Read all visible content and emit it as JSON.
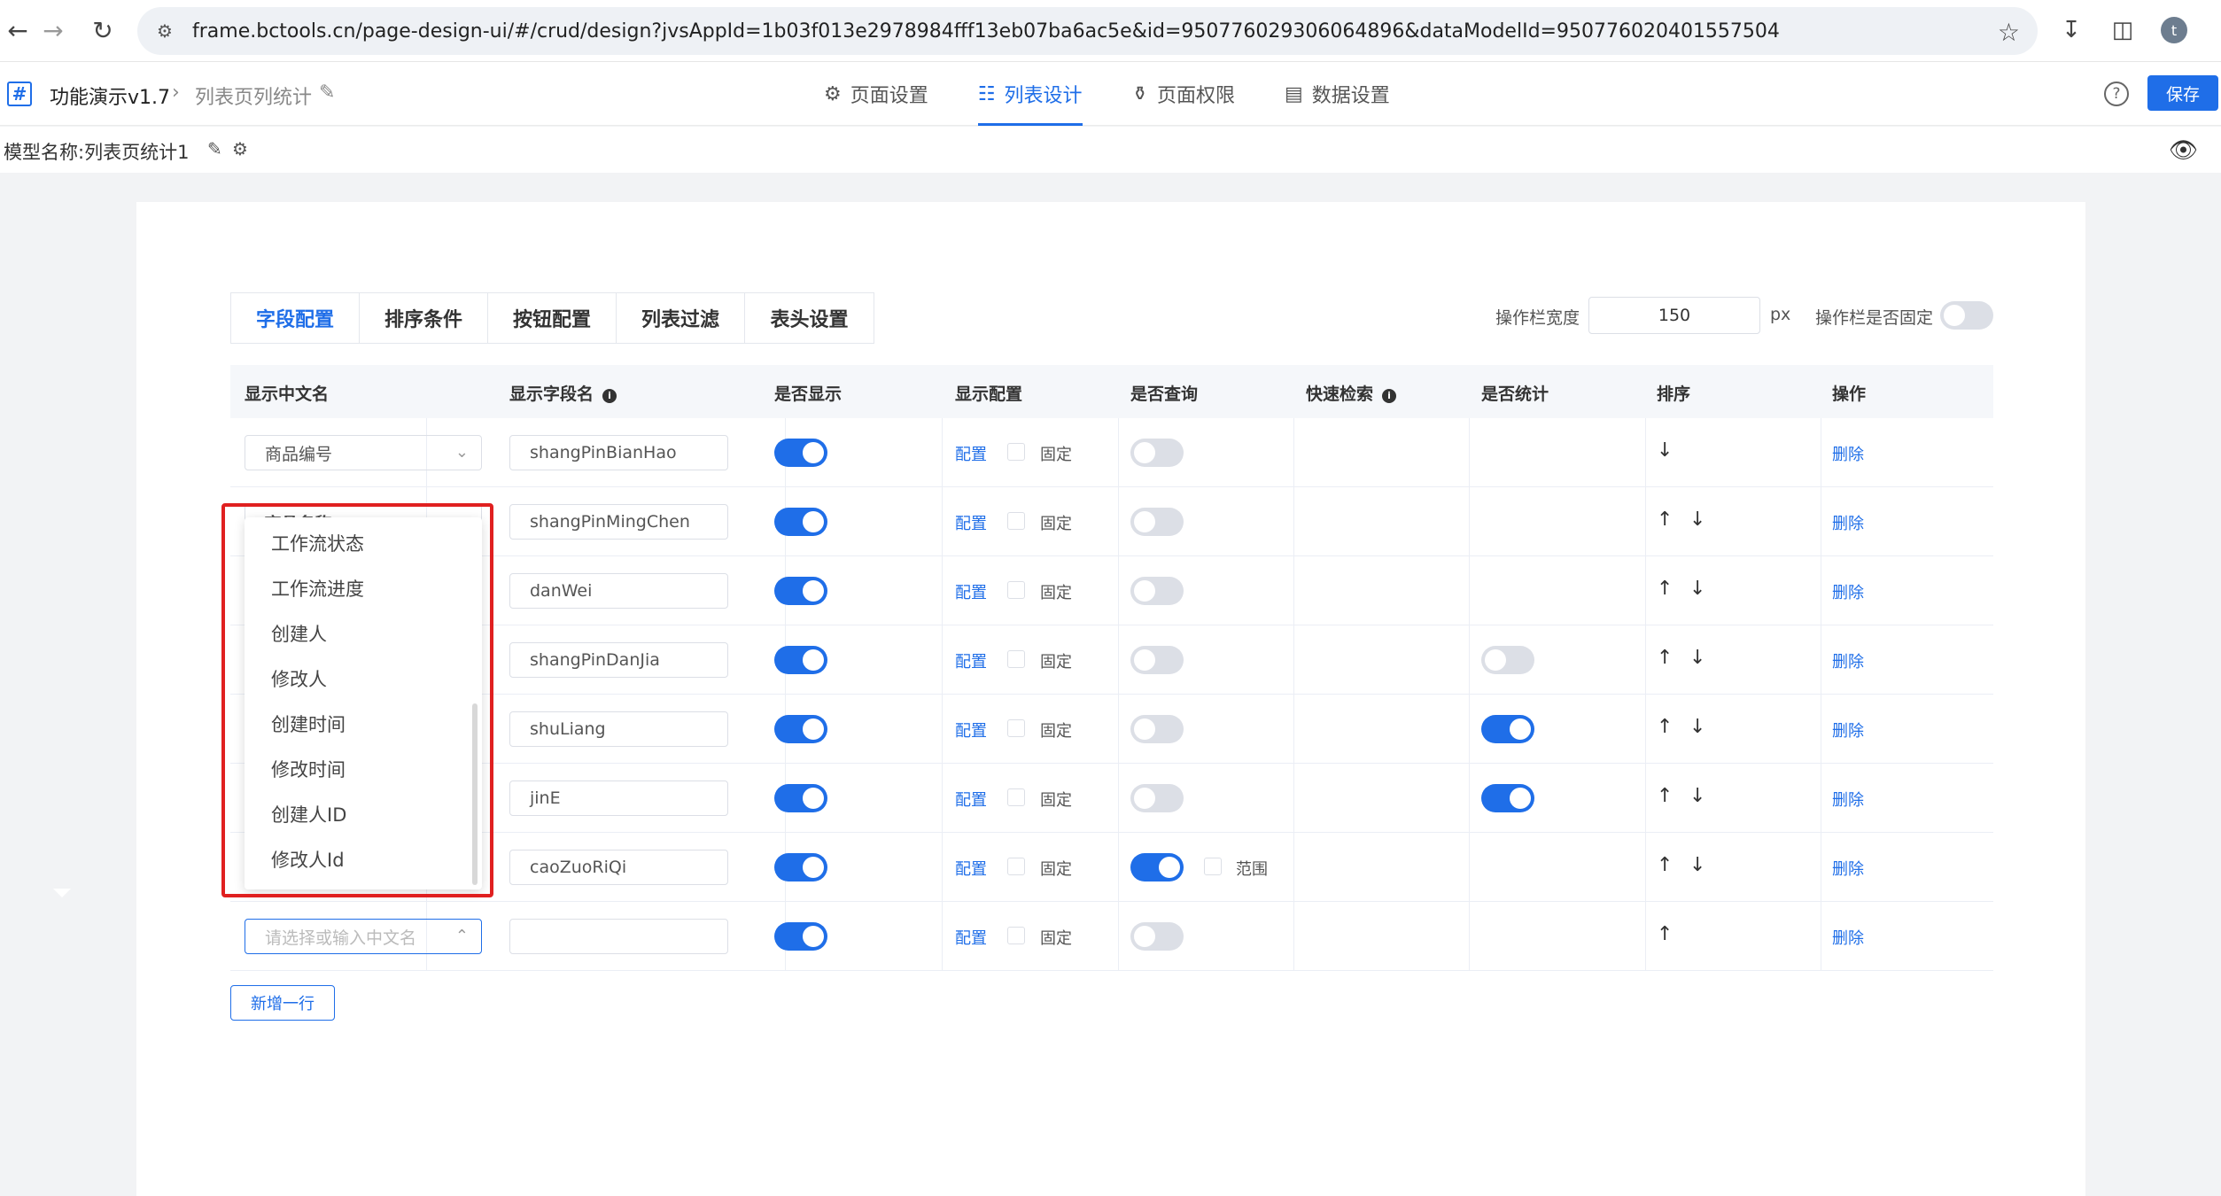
{
  "browser": {
    "url": "frame.bctools.cn/page-design-ui/#/crud/design?jvsAppId=1b03f013e2978984fff13eb07ba6ac5e&id=950776029306064896&dataModelId=950776020401557504",
    "avatar_letter": "t"
  },
  "header": {
    "app_name": "功能演示v1.7",
    "page_name": "列表页列统计",
    "tabs": [
      {
        "label": "页面设置",
        "icon": "gear-icon"
      },
      {
        "label": "列表设计",
        "icon": "list-design-icon",
        "active": true
      },
      {
        "label": "页面权限",
        "icon": "permission-icon"
      },
      {
        "label": "数据设置",
        "icon": "bar-chart-icon"
      }
    ],
    "save_label": "保存"
  },
  "model": {
    "label": "模型名称:",
    "name": "列表页统计1"
  },
  "config_tabs": [
    "字段配置",
    "排序条件",
    "按钮配置",
    "列表过滤",
    "表头设置"
  ],
  "op_bar": {
    "width_label": "操作栏宽度",
    "width_value": "150",
    "unit": "px",
    "fixed_label": "操作栏是否固定",
    "fixed": false
  },
  "table": {
    "headers": [
      "显示中文名",
      "显示字段名",
      "是否显示",
      "显示配置",
      "是否查询",
      "快速检索",
      "是否统计",
      "排序",
      "操作"
    ],
    "config_link": "配置",
    "fixed_label": "固定",
    "range_label": "范围",
    "delete_link": "删除",
    "rows": [
      {
        "cn_name": "商品编号",
        "field": "shangPinBianHao",
        "show": true,
        "query": false,
        "stat": null,
        "up": false,
        "down": true
      },
      {
        "cn_name": "商品名称",
        "field": "shangPinMingChen",
        "show": true,
        "query": false,
        "stat": null,
        "up": true,
        "down": true
      },
      {
        "cn_name": "",
        "field": "danWei",
        "show": true,
        "query": false,
        "stat": null,
        "up": true,
        "down": true
      },
      {
        "cn_name": "",
        "field": "shangPinDanJia",
        "show": true,
        "query": false,
        "stat": false,
        "up": true,
        "down": true
      },
      {
        "cn_name": "",
        "field": "shuLiang",
        "show": true,
        "query": false,
        "stat": true,
        "up": true,
        "down": true
      },
      {
        "cn_name": "",
        "field": "jinE",
        "show": true,
        "query": false,
        "stat": true,
        "up": true,
        "down": true
      },
      {
        "cn_name": "",
        "field": "caoZuoRiQi",
        "show": true,
        "query": true,
        "range": true,
        "stat": null,
        "up": true,
        "down": true
      },
      {
        "cn_name": "",
        "field": "",
        "show": true,
        "query": false,
        "stat": null,
        "up": true,
        "down": false
      }
    ],
    "new_row_placeholder": "请选择或输入中文名"
  },
  "dropdown_options": [
    "工作流状态",
    "工作流进度",
    "创建人",
    "修改人",
    "创建时间",
    "修改时间",
    "创建人ID",
    "修改人Id"
  ],
  "add_row_label": "新增一行",
  "colors": {
    "primary": "#1f6ee8",
    "highlight": "#e02020"
  }
}
